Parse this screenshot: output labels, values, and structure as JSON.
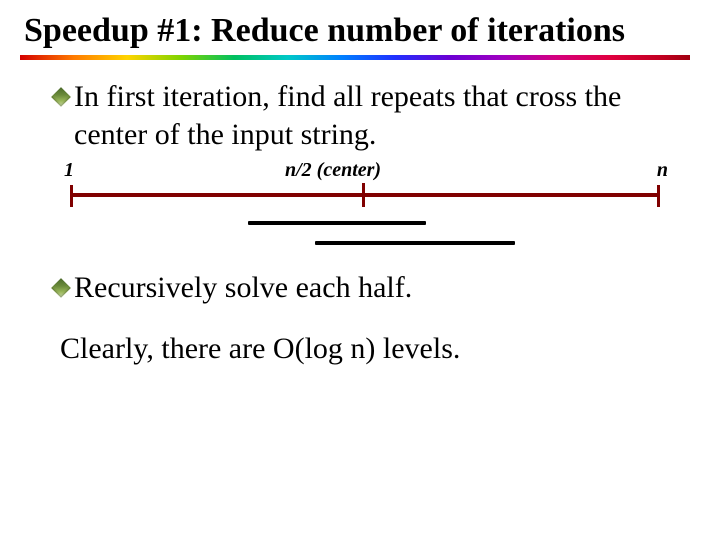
{
  "title": "Speedup #1: Reduce number of iterations",
  "bullets": {
    "b1": "In first iteration, find all repeats that cross the center of the input string.",
    "b2": "Recursively solve each half."
  },
  "diagram": {
    "left_label": "1",
    "center_label": "n/2 (center)",
    "right_label": "n"
  },
  "closing": "Clearly, there are O(log n) levels."
}
